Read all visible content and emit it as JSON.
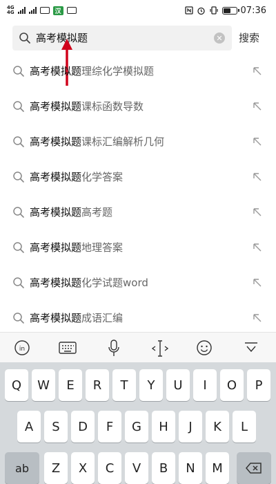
{
  "status_bar": {
    "network_top": "4G",
    "network_bottom": "4G",
    "time": "07:36",
    "app_badge": "汉",
    "battery_level": 0.6
  },
  "search": {
    "query": "高考模拟题",
    "submit_label": "搜索",
    "clear_glyph": "✕"
  },
  "suggestions": [
    {
      "prefix": "高考模拟题",
      "suffix": "理综化学模拟题"
    },
    {
      "prefix": "高考模拟题",
      "suffix": "课标函数导数"
    },
    {
      "prefix": "高考模拟题",
      "suffix": "课标汇编解析几何"
    },
    {
      "prefix": "高考模拟题",
      "suffix": "化学答案"
    },
    {
      "prefix": "高考模拟题",
      "suffix": "高考题"
    },
    {
      "prefix": "高考模拟题",
      "suffix": "地理答案"
    },
    {
      "prefix": "高考模拟题",
      "suffix": "化学试题word"
    },
    {
      "prefix": "高考模拟题",
      "suffix": "成语汇编"
    }
  ],
  "keyboard": {
    "row1": [
      "Q",
      "W",
      "E",
      "R",
      "T",
      "Y",
      "U",
      "I",
      "O",
      "P"
    ],
    "row2": [
      "A",
      "S",
      "D",
      "F",
      "G",
      "H",
      "J",
      "K",
      "L"
    ],
    "row3": [
      "Z",
      "X",
      "C",
      "V",
      "B",
      "N",
      "M"
    ],
    "shift_label": "ab",
    "toolbar_icons": [
      "input-method-icon",
      "keyboard-icon",
      "microphone-icon",
      "cursor-icon",
      "emoji-icon",
      "collapse-keyboard-icon"
    ]
  },
  "colors": {
    "annotation_arrow": "#d0021b",
    "wechat_badge": "#2b9a46",
    "keyboard_bg": "#d5d9dc"
  }
}
